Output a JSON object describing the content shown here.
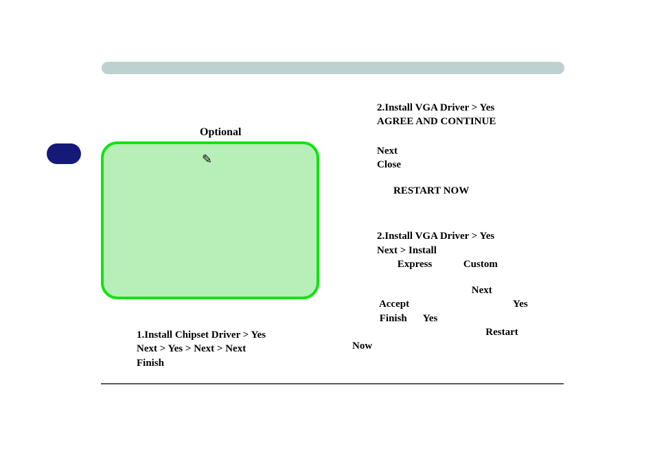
{
  "labels": {
    "optional": "Optional"
  },
  "left": {
    "line1_bold": "1.Install Chipset Driver > Yes",
    "line2_bold": "Next > Yes > Next > Next",
    "line3_bold": "Finish"
  },
  "right": {
    "a_line1_bold": "2.Install VGA Driver > Yes",
    "a_line2_bold": "AGREE AND CONTINUE",
    "a_line3_bold": "Next",
    "a_line4_bold": "Close",
    "a_line5_bold": "RESTART NOW",
    "b_line1_bold": "2.Install VGA Driver > Yes",
    "b_line2_bold": "Next > Install",
    "b_line3_express": "Express",
    "b_line3_custom": "Custom",
    "b_line4_next": "Next",
    "b_line5_accept": "Accept",
    "b_line5_yes": "Yes",
    "b_line6_finish": "Finish",
    "b_line6_yes2": "Yes",
    "b_line7_restart": "Restart",
    "b_line7_now": "Now"
  }
}
